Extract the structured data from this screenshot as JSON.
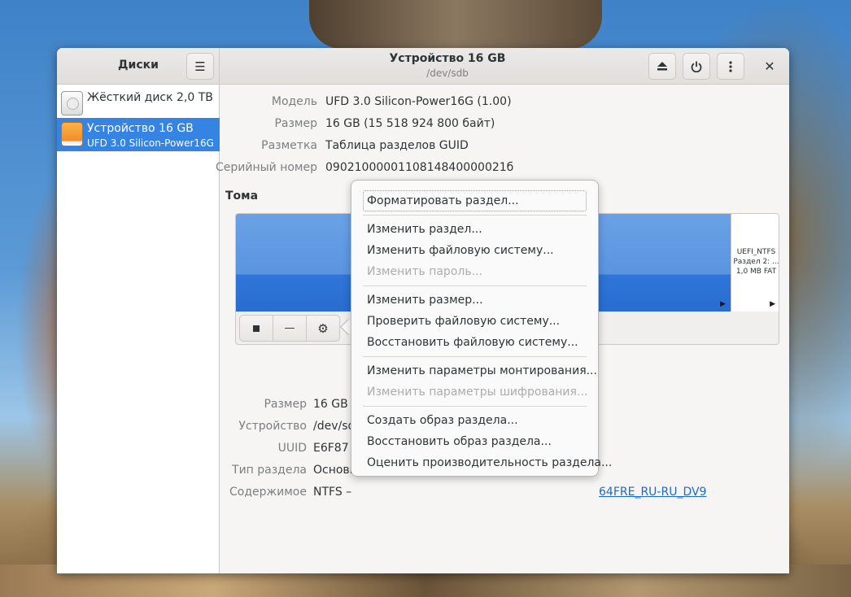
{
  "window": {
    "sidebar_title": "Диски",
    "title": "Устройство 16 GB",
    "subtitle": "/dev/sdb"
  },
  "icons": {
    "menu": "hamburger-menu-icon",
    "eject": "eject-icon",
    "power": "power-icon",
    "more": "vertical-dots-icon",
    "close": "close-icon",
    "stop": "stop-icon",
    "remove": "minus-icon",
    "settings": "gears-icon"
  },
  "sidebar": {
    "items": [
      {
        "name": "Жёсткий диск 2,0 TB",
        "sub": ""
      },
      {
        "name": "Устройство 16 GB",
        "sub": "UFD 3.0 Silicon-Power16G"
      }
    ]
  },
  "drive_info": [
    {
      "label": "Модель",
      "value": "UFD 3.0 Silicon-Power16G (1.00)"
    },
    {
      "label": "Размер",
      "value": "16 GB (15 518 924 800 байт)"
    },
    {
      "label": "Разметка",
      "value": "Таблица разделов GUID"
    },
    {
      "label": "Серийный номер",
      "value": "0902100000110814840000021б"
    }
  ],
  "volumes": {
    "title": "Тома",
    "side_partition": {
      "line1": "UEFI_NTFS",
      "line2": "Раздел 2: ...",
      "line3": "1,0 MB FAT"
    }
  },
  "partition_info": [
    {
      "label": "Размер",
      "value": "16 GB –"
    },
    {
      "label": "Устройство",
      "value": "/dev/sd"
    },
    {
      "label": "UUID",
      "value": "E6F87"
    },
    {
      "label": "Тип раздела",
      "value": "Основн"
    },
    {
      "label": "Содержимое",
      "value": "NTFS –",
      "link": "64FRE_RU-RU_DV9"
    }
  ],
  "menu": {
    "groups": [
      [
        {
          "label": "Форматировать раздел...",
          "enabled": true,
          "focused": true
        }
      ],
      [
        {
          "label": "Изменить раздел...",
          "enabled": true
        },
        {
          "label": "Изменить файловую систему...",
          "enabled": true
        },
        {
          "label": "Изменить пароль...",
          "enabled": false
        }
      ],
      [
        {
          "label": "Изменить размер...",
          "enabled": true
        },
        {
          "label": "Проверить файловую систему...",
          "enabled": true
        },
        {
          "label": "Восстановить файловую систему...",
          "enabled": true
        }
      ],
      [
        {
          "label": "Изменить параметры монтирования...",
          "enabled": true
        },
        {
          "label": "Изменить параметры шифрования...",
          "enabled": false
        }
      ],
      [
        {
          "label": "Создать образ раздела...",
          "enabled": true
        },
        {
          "label": "Восстановить образ раздела...",
          "enabled": true
        },
        {
          "label": "Оценить производительность раздела...",
          "enabled": true
        }
      ]
    ]
  }
}
